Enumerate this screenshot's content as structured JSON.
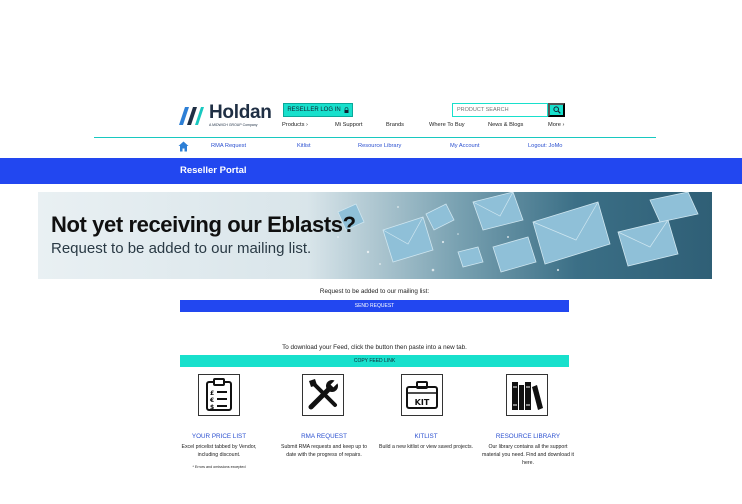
{
  "header": {
    "logo": {
      "name": "Holdan",
      "tagline": "A MIDWICH GROUP Company"
    },
    "login_label": "RESELLER LOG IN",
    "search_placeholder": "PRODUCT SEARCH",
    "main_nav": [
      "Products",
      "Mi Support",
      "Brands",
      "Where To Buy",
      "News & Blogs",
      "More"
    ],
    "sub_nav": [
      "RMA Request",
      "Kitlist",
      "Resource Library",
      "My Account",
      "Logout: JoMo"
    ]
  },
  "portal_title": "Reseller Portal",
  "banner": {
    "headline": "Not yet receiving our Eblasts?",
    "subline": "Request to be added to our mailing list."
  },
  "mailing": {
    "prompt": "Request to be added to our mailing list:",
    "button": "SEND REQUEST"
  },
  "feed": {
    "prompt": "To download your Feed, click the button then paste into a new tab.",
    "button": "COPY FEED LINK"
  },
  "tiles": [
    {
      "title": "YOUR PRICE LIST",
      "desc": "Excel pricelist tabbed by Vendor, including discount.",
      "note": "* Errors and omissions excepted",
      "icon": "price-list-icon"
    },
    {
      "title": "RMA REQUEST",
      "desc": "Submit RMA requests and keep up to date with the progress of repairs.",
      "icon": "tools-icon"
    },
    {
      "title": "KITLIST",
      "desc": "Build a new kitlist or view saved projects.",
      "icon": "kit-case-icon",
      "icon_label": "KIT"
    },
    {
      "title": "RESOURCE LIBRARY",
      "desc": "Our library contains all the support material you need. Find and download it here.",
      "icon": "library-books-icon"
    }
  ],
  "colors": {
    "brand_blue": "#2247f0",
    "accent_teal": "#18e0cc",
    "link_blue": "#2b50d0"
  }
}
